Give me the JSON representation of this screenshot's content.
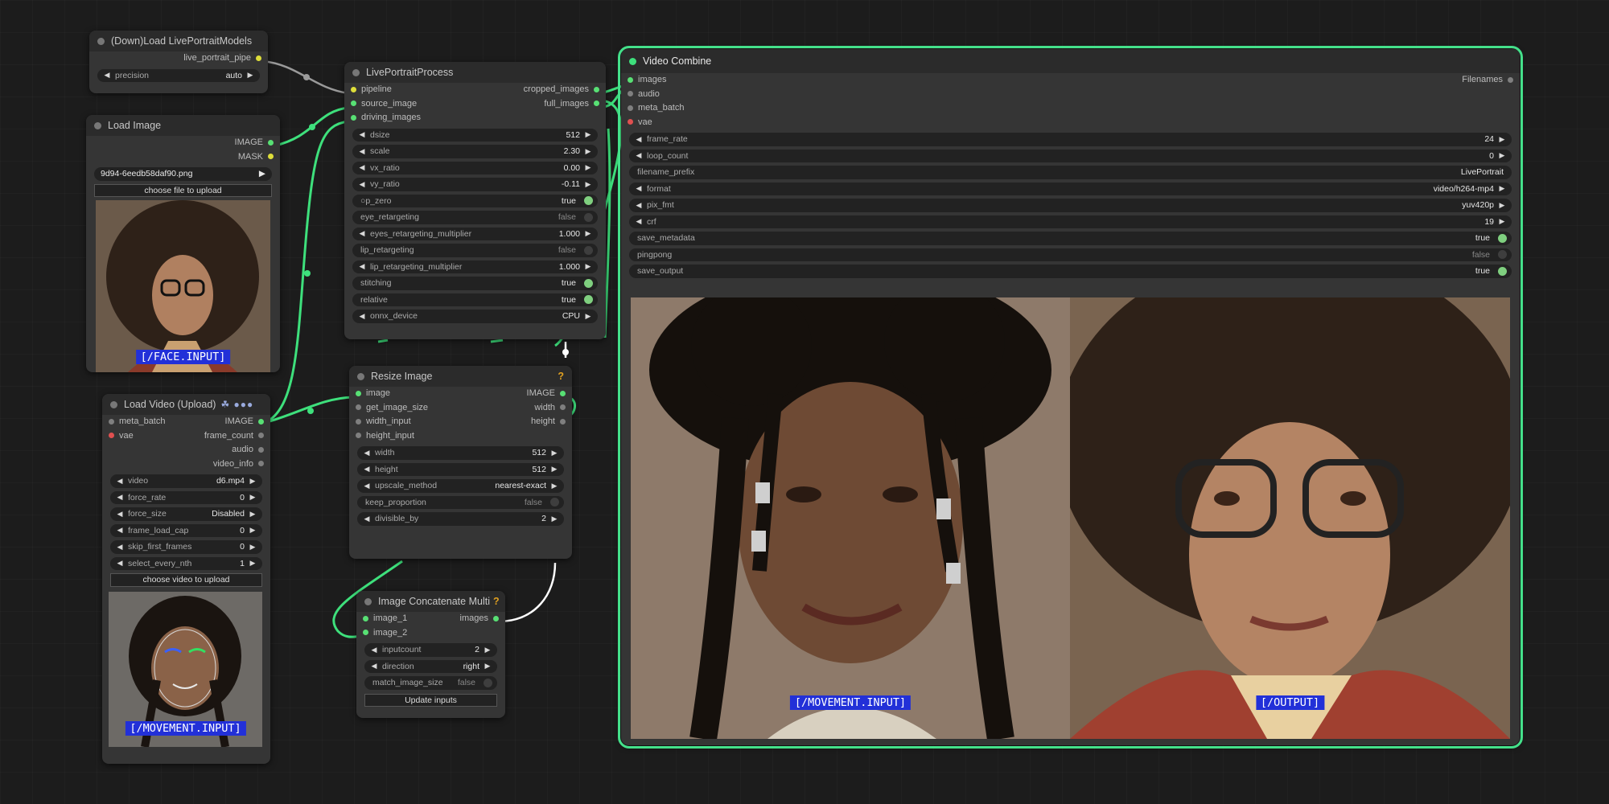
{
  "load_models": {
    "title": "(Down)Load LivePortraitModels",
    "output": "live_portrait_pipe",
    "precision_label": "precision",
    "precision_value": "auto"
  },
  "load_image": {
    "title": "Load Image",
    "outputs": [
      "IMAGE",
      "MASK"
    ],
    "filename": "9d94-6eedb58daf90.png",
    "upload_label": "choose file to upload",
    "preview_label": "[/FACE.INPUT]"
  },
  "load_video": {
    "title": "Load Video (Upload)",
    "title_extra": "☘ ●●●",
    "inputs": [
      "meta_batch",
      "vae"
    ],
    "outputs": [
      "IMAGE",
      "frame_count",
      "audio",
      "video_info"
    ],
    "widgets": [
      {
        "label": "video",
        "value": "d6.mp4"
      },
      {
        "label": "force_rate",
        "value": "0"
      },
      {
        "label": "force_size",
        "value": "Disabled"
      },
      {
        "label": "frame_load_cap",
        "value": "0"
      },
      {
        "label": "skip_first_frames",
        "value": "0"
      },
      {
        "label": "select_every_nth",
        "value": "1"
      }
    ],
    "upload_label": "choose video to upload",
    "preview_label": "[/MOVEMENT.INPUT]"
  },
  "liveportrait": {
    "title": "LivePortraitProcess",
    "inputs": [
      "pipeline",
      "source_image",
      "driving_images"
    ],
    "outputs": [
      "cropped_images",
      "full_images"
    ],
    "widgets": [
      {
        "label": "dsize",
        "value": "512",
        "kind": "num"
      },
      {
        "label": "scale",
        "value": "2.30",
        "kind": "num"
      },
      {
        "label": "vx_ratio",
        "value": "0.00",
        "kind": "num"
      },
      {
        "label": "vy_ratio",
        "value": "-0.11",
        "kind": "num"
      },
      {
        "label": "○p_zero",
        "value": "true",
        "kind": "on"
      },
      {
        "label": "eye_retargeting",
        "value": "false",
        "kind": "off"
      },
      {
        "label": "eyes_retargeting_multiplier",
        "value": "1.000",
        "kind": "num"
      },
      {
        "label": "lip_retargeting",
        "value": "false",
        "kind": "off"
      },
      {
        "label": "lip_retargeting_multiplier",
        "value": "1.000",
        "kind": "num"
      },
      {
        "label": "stitching",
        "value": "true",
        "kind": "on"
      },
      {
        "label": "relative",
        "value": "true",
        "kind": "on"
      },
      {
        "label": "onnx_device",
        "value": "CPU",
        "kind": "num"
      }
    ]
  },
  "resize": {
    "title": "Resize Image",
    "badge": "?",
    "inputs": [
      "image",
      "get_image_size",
      "width_input",
      "height_input"
    ],
    "outputs": [
      "IMAGE",
      "width",
      "height"
    ],
    "widgets": [
      {
        "label": "width",
        "value": "512",
        "kind": "num"
      },
      {
        "label": "height",
        "value": "512",
        "kind": "num"
      },
      {
        "label": "upscale_method",
        "value": "nearest-exact",
        "kind": "num"
      },
      {
        "label": "keep_proportion",
        "value": "false",
        "kind": "off"
      },
      {
        "label": "divisible_by",
        "value": "2",
        "kind": "num"
      }
    ]
  },
  "concat": {
    "title": "Image Concatenate Multi",
    "badge": "?",
    "inputs": [
      "image_1",
      "image_2"
    ],
    "output": "images",
    "widgets": [
      {
        "label": "inputcount",
        "value": "2",
        "kind": "num"
      },
      {
        "label": "direction",
        "value": "right",
        "kind": "num"
      },
      {
        "label": "match_image_size",
        "value": "false",
        "kind": "off"
      }
    ],
    "button": "Update inputs"
  },
  "video_combine": {
    "title": "Video Combine",
    "inputs": [
      "images",
      "audio",
      "meta_batch",
      "vae"
    ],
    "output": "Filenames",
    "widgets": [
      {
        "label": "frame_rate",
        "value": "24",
        "kind": "num"
      },
      {
        "label": "loop_count",
        "value": "0",
        "kind": "num"
      },
      {
        "label": "filename_prefix",
        "value": "LivePortrait",
        "kind": "text"
      },
      {
        "label": "format",
        "value": "video/h264-mp4",
        "kind": "num"
      },
      {
        "label": "pix_fmt",
        "value": "yuv420p",
        "kind": "num"
      },
      {
        "label": "crf",
        "value": "19",
        "kind": "num"
      },
      {
        "label": "save_metadata",
        "value": "true",
        "kind": "on"
      },
      {
        "label": "pingpong",
        "value": "false",
        "kind": "off"
      },
      {
        "label": "save_output",
        "value": "true",
        "kind": "on"
      }
    ],
    "preview_left_label": "[/MOVEMENT.INPUT]",
    "preview_right_label": "[/OUTPUT]"
  },
  "colors": {
    "wire": "#3ee07c",
    "highlight": "#44e08a",
    "label_bg": "#2230d8"
  }
}
